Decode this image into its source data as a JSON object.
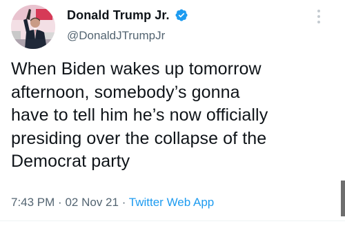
{
  "author": {
    "display_name": "Donald Trump Jr.",
    "handle": "@DonaldJTrumpJr",
    "verified": true,
    "verified_color": "#1d9bf0"
  },
  "tweet": {
    "text": "When Biden wakes up tomorrow\nafternoon, somebody’s gonna\nhave to tell him he’s now officially\npresiding over the collapse of the\nDemocrat party",
    "time": "7:43 PM",
    "separator": "·",
    "date": "02 Nov 21",
    "app": "Twitter Web App"
  },
  "icons": {
    "verified": "verified-badge-icon",
    "more": "more-options-icon"
  },
  "colors": {
    "text": "#0f1419",
    "secondary": "#536471",
    "accent": "#1d9bf0"
  }
}
